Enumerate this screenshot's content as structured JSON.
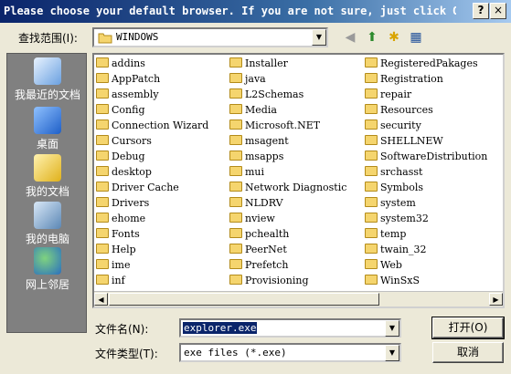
{
  "window": {
    "title": "Please choose your default browser. If you are not sure, just click Op...",
    "help_glyph": "?",
    "close_glyph": "×"
  },
  "lookin": {
    "label": "查找范围(I):",
    "value": "WINDOWS"
  },
  "places": [
    {
      "label": "我最近的文档",
      "icon": "recent-documents-icon"
    },
    {
      "label": "桌面",
      "icon": "desktop-icon"
    },
    {
      "label": "我的文档",
      "icon": "my-documents-icon"
    },
    {
      "label": "我的电脑",
      "icon": "my-computer-icon"
    },
    {
      "label": "网上邻居",
      "icon": "network-places-icon"
    }
  ],
  "files": {
    "col1": [
      "addins",
      "AppPatch",
      "assembly",
      "Config",
      "Connection Wizard",
      "Cursors",
      "Debug",
      "desktop",
      "Driver Cache",
      "Drivers",
      "ehome",
      "Fonts",
      "Help",
      "ime",
      "inf"
    ],
    "col2": [
      "Installer",
      "java",
      "L2Schemas",
      "Media",
      "Microsoft.NET",
      "msagent",
      "msapps",
      "mui",
      "Network Diagnostic",
      "NLDRV",
      "nview",
      "pchealth",
      "PeerNet",
      "Prefetch",
      "Provisioning"
    ],
    "col3": [
      "RegisteredPakages",
      "Registration",
      "repair",
      "Resources",
      "security",
      "SHELLNEW",
      "SoftwareDistribution",
      "srchasst",
      "Symbols",
      "system",
      "system32",
      "temp",
      "twain_32",
      "Web",
      "WinSxS"
    ]
  },
  "filename": {
    "label": "文件名(N):",
    "value": "explorer.exe"
  },
  "filetype": {
    "label": "文件类型(T):",
    "value": "exe files (*.exe)"
  },
  "buttons": {
    "open": "打开(O)",
    "cancel": "取消"
  }
}
